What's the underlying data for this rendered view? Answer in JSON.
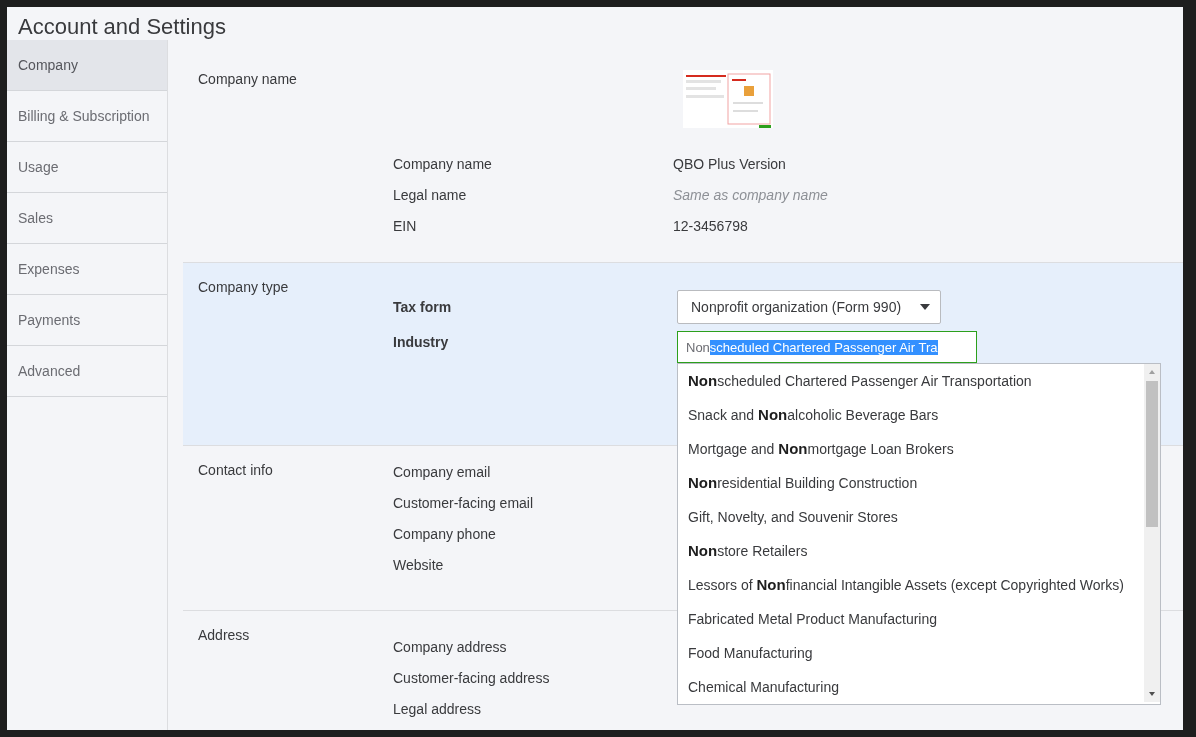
{
  "window": {
    "title": "Account and Settings"
  },
  "sidebar": {
    "items": [
      {
        "label": "Company",
        "selected": true
      },
      {
        "label": "Billing & Subscription",
        "selected": false
      },
      {
        "label": "Usage",
        "selected": false
      },
      {
        "label": "Sales",
        "selected": false
      },
      {
        "label": "Expenses",
        "selected": false
      },
      {
        "label": "Payments",
        "selected": false
      },
      {
        "label": "Advanced",
        "selected": false
      }
    ]
  },
  "sections": [
    {
      "title": "Company name",
      "logo": {
        "kind": "picture"
      },
      "rows": [
        {
          "label": "Company name",
          "value": "QBO Plus Version"
        },
        {
          "label": "Legal name",
          "placeholder": "Same as company name"
        },
        {
          "label": "EIN",
          "value": "12-3456798"
        }
      ]
    },
    {
      "title": "Company type",
      "highlighted": true,
      "tax_form": {
        "label": "Tax form",
        "value": "Nonprofit organization (Form 990)"
      },
      "industry": {
        "label": "Industry",
        "typed": "Non",
        "autocompleted": "scheduled Chartered Passenger Air Tra",
        "options": [
          "**Non**scheduled Chartered Passenger Air Transportation",
          "Snack and **Non**alcoholic Beverage Bars",
          "Mortgage and **Non**mortgage Loan Brokers",
          "**Non**residential Building Construction",
          "Gift, Novelty, and Souvenir Stores",
          "**Non**store Retailers",
          "Lessors of **Non**financial Intangible Assets (except Copyrighted Works)",
          "Fabricated Metal Product Manufacturing",
          "Food Manufacturing",
          "Chemical Manufacturing"
        ]
      }
    },
    {
      "title": "Contact info",
      "highlighted": false,
      "rows": [
        {
          "label": "Company email"
        },
        {
          "label": "Customer-facing email"
        },
        {
          "label": "Company phone"
        },
        {
          "label": "Website"
        }
      ]
    },
    {
      "title": "Address",
      "highlighted": false,
      "rows": [
        {
          "label": "Company address"
        },
        {
          "label": "Customer-facing address"
        },
        {
          "label": "Legal address"
        }
      ]
    }
  ]
}
